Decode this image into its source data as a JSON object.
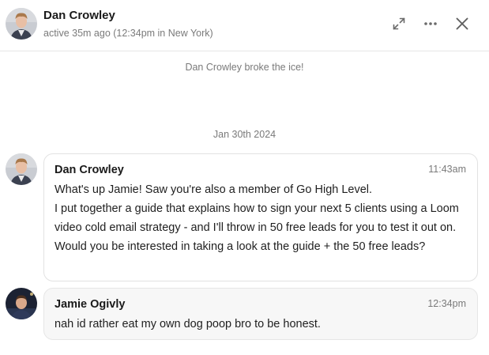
{
  "header": {
    "name": "Dan Crowley",
    "status": "active 35m ago (12:34pm in New York)",
    "icons": [
      "expand-icon",
      "more-options-icon",
      "close-icon"
    ]
  },
  "system_message": "Dan Crowley broke the ice!",
  "date_separator": "Jan 30th 2024",
  "messages": [
    {
      "sender": "Dan Crowley",
      "time": "11:43am",
      "lines": [
        "What's up Jamie! Saw you're also a member of Go High Level.",
        "I put together a guide that explains how to sign your next 5 clients using a Loom video cold email strategy - and I'll throw in 50 free leads for you to test it out on.",
        "Would you be interested in taking a look at the guide + the 50 free leads?"
      ]
    },
    {
      "sender": "Jamie Ogivly",
      "time": "12:34pm",
      "lines": [
        "nah id rather eat my own dog poop bro to be honest."
      ]
    }
  ],
  "colors": {
    "muted_text": "#7a7a7a",
    "border": "#e2e2e2",
    "reply_bubble_bg": "#f7f7f7"
  }
}
